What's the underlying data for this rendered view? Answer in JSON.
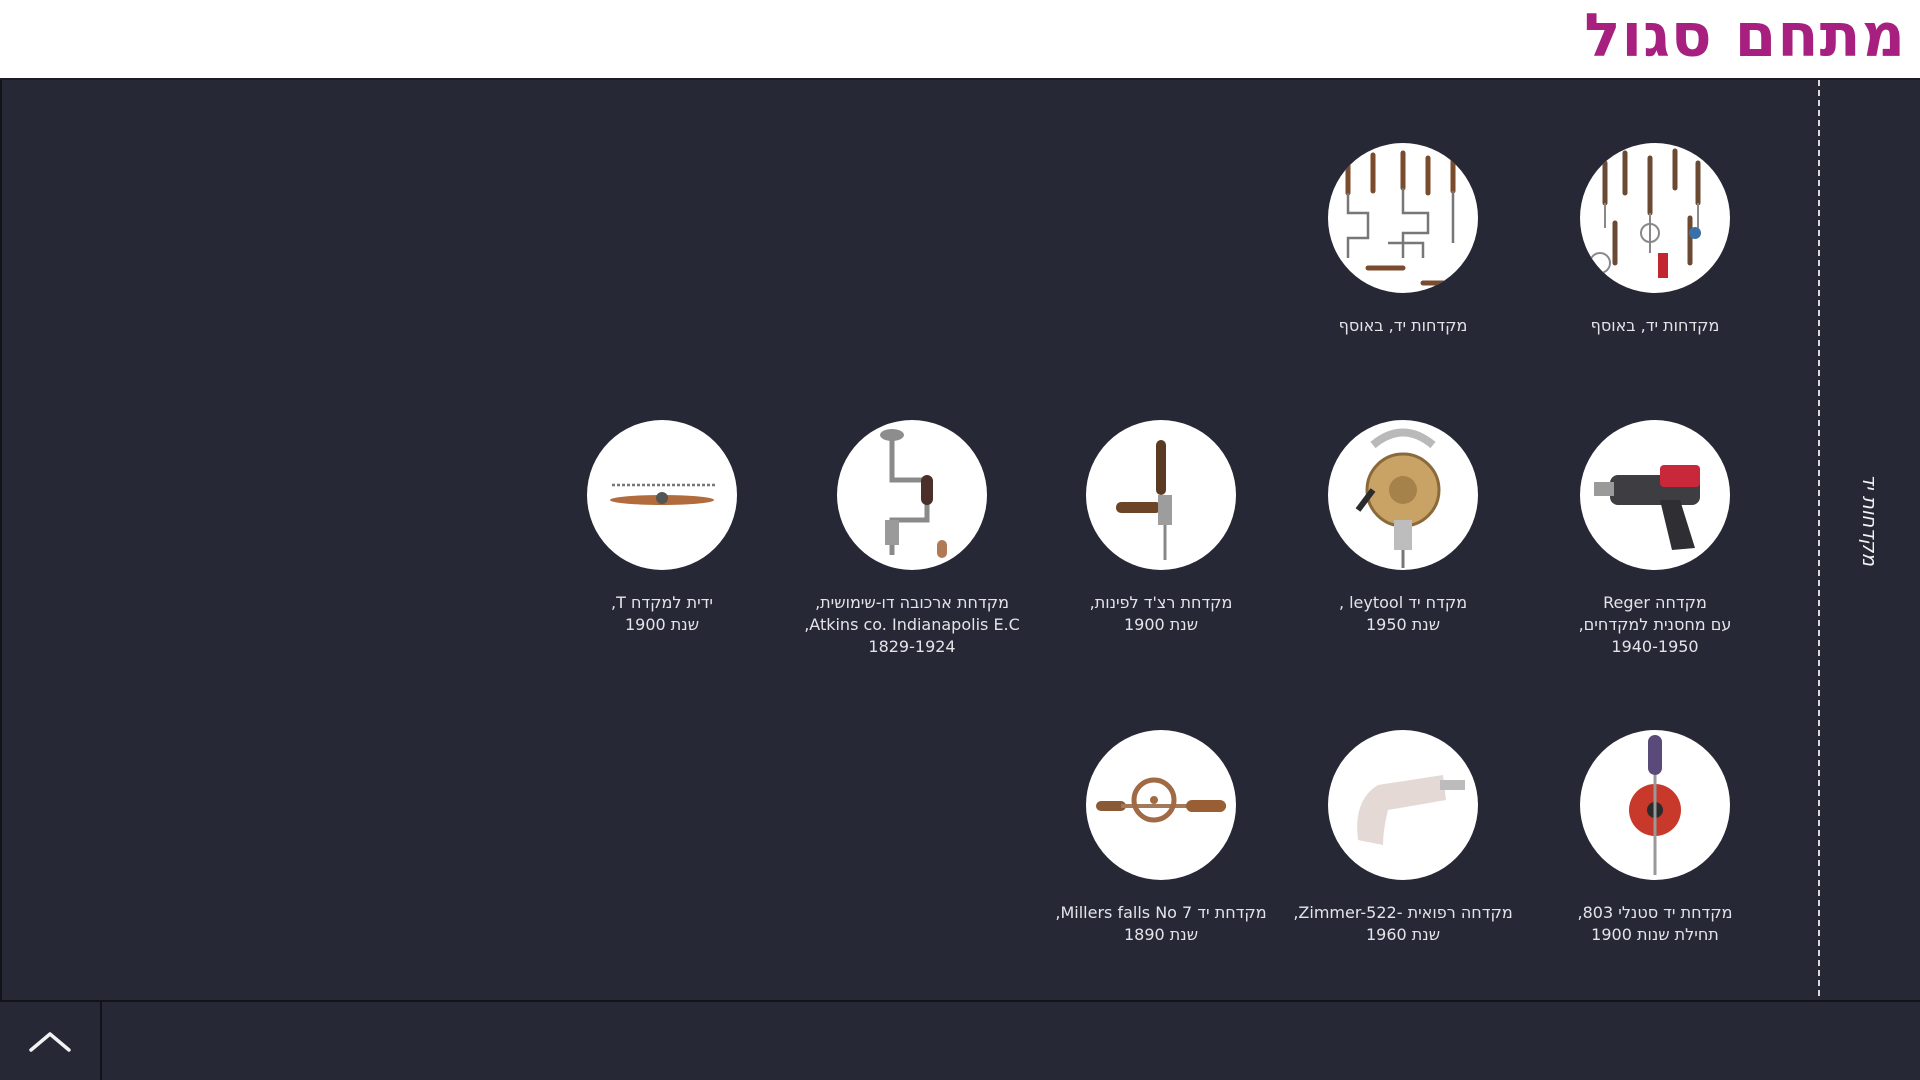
{
  "header": {
    "title": "מתחם סגול"
  },
  "side_tab": {
    "label": "מקדחות יד"
  },
  "gallery": {
    "items": [
      {
        "name": "collection-1",
        "lines": [
          "מקדחות יד, באוסף"
        ],
        "icon": "hand-drills-collection-photo"
      },
      {
        "name": "collection-2",
        "lines": [
          "מקדחות יד, באוסף"
        ],
        "icon": "hand-drills-collection-photo"
      },
      {
        "name": "reger",
        "lines": [
          "מקדחה Reger",
          "עם מחסנית למקדחים,",
          "1940-1950"
        ],
        "icon": "pistol-drill-photo"
      },
      {
        "name": "leytool",
        "lines": [
          "מקדח יד leytool ,",
          "שנת 1950"
        ],
        "icon": "brass-hand-drill-photo"
      },
      {
        "name": "ratchet",
        "lines": [
          "מקדחת רצ'ד לפינות,",
          "שנת 1900"
        ],
        "icon": "ratchet-drill-photo"
      },
      {
        "name": "brace",
        "lines": [
          "מקדחת ארכובה דו-שימושית,",
          "Atkins co. Indianapolis E.C,",
          "1829-1924"
        ],
        "icon": "brace-drill-photo"
      },
      {
        "name": "t-handle",
        "lines": [
          "ידית למקדח T,",
          "שנת 1900"
        ],
        "icon": "t-handle-auger-photo"
      },
      {
        "name": "stanley",
        "lines": [
          "מקדחת יד סטנלי 803,",
          "תחילת שנות 1900"
        ],
        "icon": "egg-beater-drill-photo"
      },
      {
        "name": "zimmer",
        "lines": [
          "מקדחה רפואית -Zimmer-522,",
          "שנת 1960"
        ],
        "icon": "medical-drill-photo"
      },
      {
        "name": "millers",
        "lines": [
          "מקדחת יד Millers falls No 7,",
          "שנת 1890"
        ],
        "icon": "millers-falls-drill-photo"
      }
    ]
  },
  "footer": {
    "back_to_top_icon": "chevron-up-icon"
  },
  "colors": {
    "title": "#a7207f",
    "background": "#262836",
    "text": "#e4e4e8"
  }
}
